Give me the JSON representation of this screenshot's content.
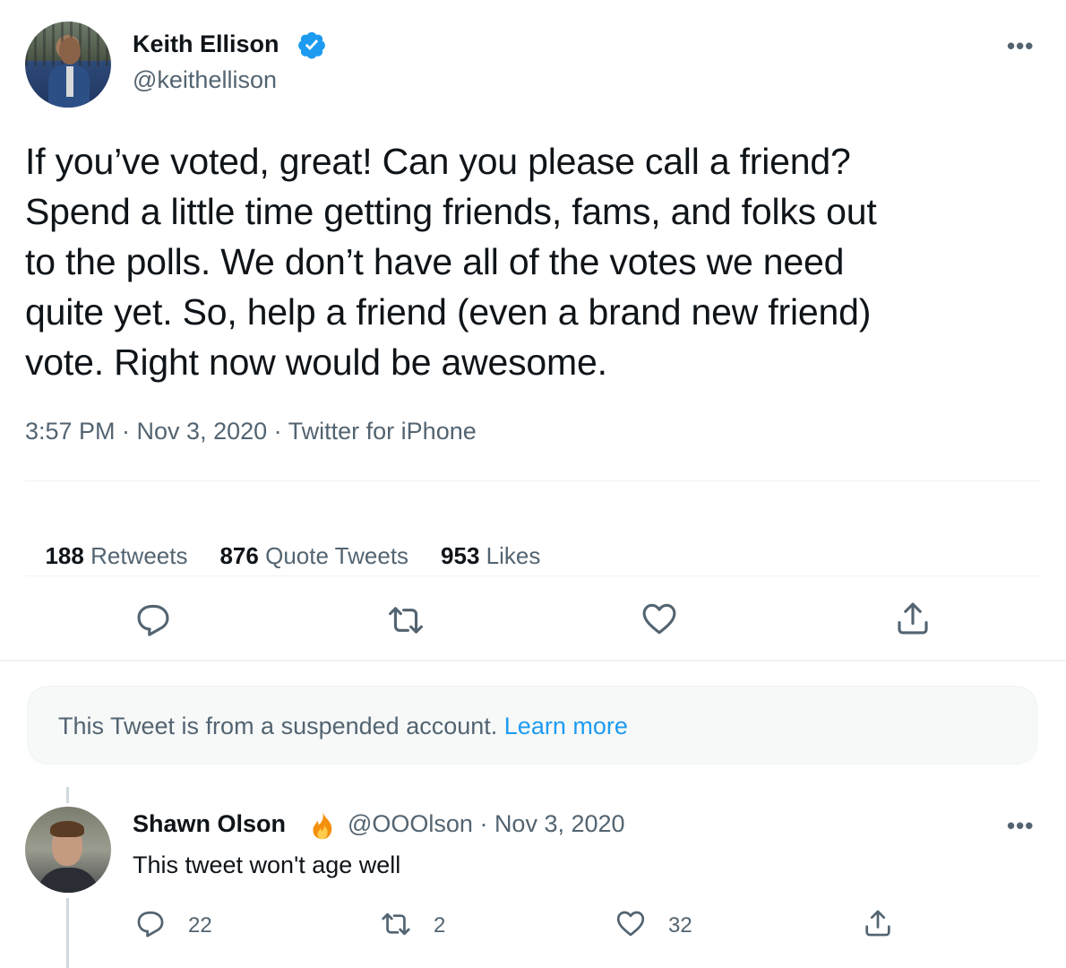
{
  "tweet": {
    "author_name": "Keith Ellison",
    "author_handle": "@keithellison",
    "text": "If you’ve voted, great! Can you please  call a friend?\nSpend a little time getting friends, fams, and folks out\nto the polls.  We don’t have all of the votes we need\nquite yet.  So, help a friend (even a brand new friend)\nvote. Right now would be awesome.",
    "meta": "3:57 PM · Nov 3, 2020 · Twitter for iPhone",
    "more_label": "•••",
    "stats": {
      "retweets_count": "188",
      "retweets_label": "Retweets",
      "quotes_count": "876",
      "quotes_label": "Quote Tweets",
      "likes_count": "953",
      "likes_label": "Likes"
    },
    "actions": [
      "reply-icon",
      "retweet-icon",
      "like-icon",
      "share-icon"
    ]
  },
  "notice": {
    "text": "This Tweet is from a suspended account.",
    "link": "Learn more"
  },
  "reply": {
    "author_name": "Shawn Olson",
    "badge_icon": "fire-emoji",
    "handle_date": "@OOOlson · Nov 3, 2020",
    "text": "This tweet won't age well",
    "more_label": "•••",
    "reply_count": "22",
    "retweet_count": "2",
    "like_count": "32"
  },
  "colors": {
    "text": "#0f1419",
    "secondary": "#536471",
    "link": "#1d9bf0",
    "verified": "#1d9bf0",
    "divider": "#eff3f4"
  }
}
